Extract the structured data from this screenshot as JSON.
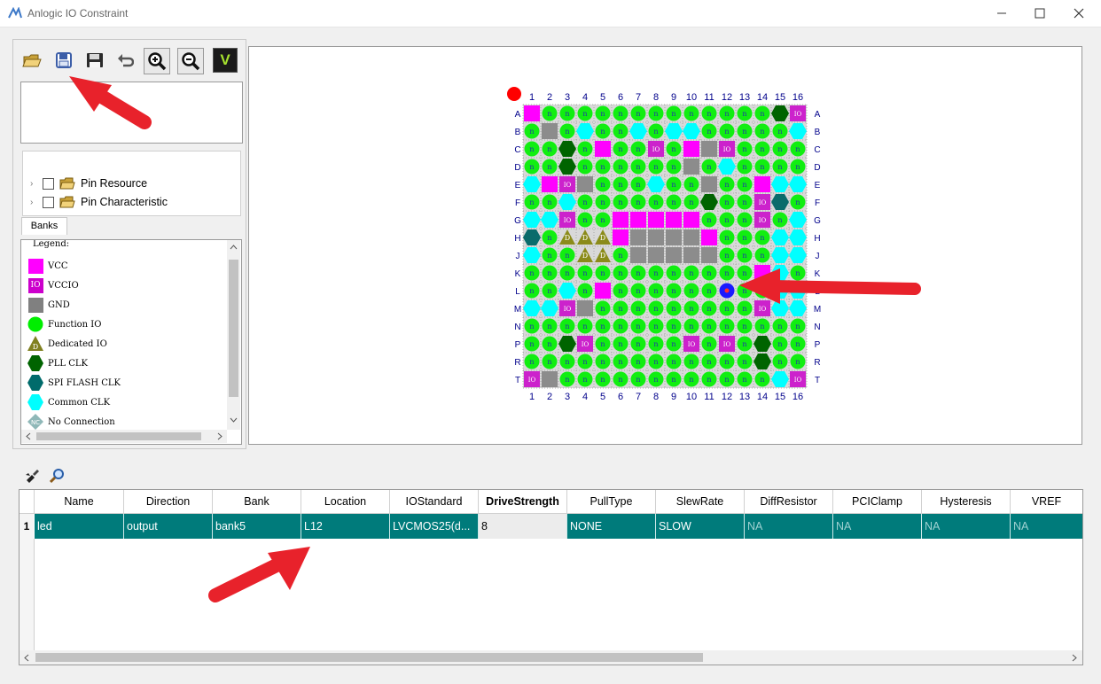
{
  "window": {
    "title": "Anlogic IO Constraint"
  },
  "toolbar": {
    "items": [
      "open-icon",
      "save-icon",
      "save-as-icon",
      "undo-icon",
      "zoom-in-icon",
      "zoom-out-icon",
      "validate-icon"
    ],
    "validate_label": "V"
  },
  "tree": {
    "items": [
      {
        "label": "Pin Resource"
      },
      {
        "label": "Pin Characteristic"
      }
    ]
  },
  "tabs": {
    "banks": "Banks"
  },
  "legend": {
    "title": "Legend:",
    "items": [
      {
        "label": "VCC",
        "icon": "vcc-swatch",
        "color": "#ff00ff"
      },
      {
        "label": "VCCIO",
        "icon": "vccio-swatch",
        "color": "#cc00cc",
        "text": "IO"
      },
      {
        "label": "GND",
        "icon": "gnd-swatch",
        "color": "#808080"
      },
      {
        "label": "Function IO",
        "icon": "function-io-circle",
        "color": "#00ee00"
      },
      {
        "label": "Dedicated IO",
        "icon": "dedicated-io-triangle",
        "color": "#808020",
        "text": "D"
      },
      {
        "label": "PLL CLK",
        "icon": "pll-clk-hexagon",
        "color": "#006400"
      },
      {
        "label": "SPI FLASH CLK",
        "icon": "spi-flash-clk-hexagon",
        "color": "#006b6b"
      },
      {
        "label": "Common CLK",
        "icon": "common-clk-hexagon",
        "color": "#00ffff"
      },
      {
        "label": "No Connection",
        "icon": "no-connection-diamond",
        "color": "#8fb8b8",
        "text": "NC"
      }
    ]
  },
  "pinmap": {
    "columns": [
      "1",
      "2",
      "3",
      "4",
      "5",
      "6",
      "7",
      "8",
      "9",
      "10",
      "11",
      "12",
      "13",
      "14",
      "15",
      "16"
    ],
    "rows": [
      "A",
      "B",
      "C",
      "D",
      "E",
      "F",
      "G",
      "H",
      "J",
      "K",
      "L",
      "M",
      "N",
      "P",
      "R",
      "T"
    ],
    "cells": [
      "VFFFFFFFFFFFFFPI",
      "FGFCFFCFCCFFFFFC",
      "FFPFVFFIFVGIFFFF",
      "FFPFFFFFFGFCFFFF",
      "CVIGFFFCFFGFFVCC",
      "FFCFFFFFFFPFFIXF",
      "CCIFFVVVVVFFFIFC",
      "XFDDDVGGGGVFFFCC",
      "CFFDDFGGGGGFFFCC",
      "FFFFFFFFFFFFFVCF",
      "FFCFVFFFFFFFFFCC",
      "CCIGFFFFFFFFFICC",
      "FFFFFFFFFFFFFFFF",
      "FFPIFFFFFIFIFPFF",
      "FFFFFFFFFFFFFPFF",
      "IGFFFFFFFFFFFFCI"
    ],
    "cell_labels": {
      "F": "n",
      "I": "IO",
      "D": "D"
    },
    "selected_pin": "L12",
    "colors": {
      "V": "#ff00ff",
      "I": "#cc22cc",
      "G": "#8c8c8c",
      "F": "#11ee11",
      "C": "#00ffff",
      "P": "#006400",
      "X": "#0a6b6b",
      "D": "#8b8b1a",
      "selected": "#1a1aff",
      "header": "#00008b",
      "corner": "#ff0000"
    }
  },
  "bottom_toolbar": {
    "items": [
      "clear-icon",
      "find-icon"
    ]
  },
  "table": {
    "columns": [
      "Name",
      "Direction",
      "Bank",
      "Location",
      "IOStandard",
      "DriveStrength",
      "PullType",
      "SlewRate",
      "DiffResistor",
      "PCIClamp",
      "Hysteresis",
      "VREF"
    ],
    "rows": [
      {
        "index": "1",
        "cells": [
          "led",
          "output",
          "bank5",
          "L12",
          "LVCMOS25(d...",
          "8",
          "NONE",
          "SLOW",
          "NA",
          "NA",
          "NA",
          "NA"
        ]
      }
    ]
  },
  "annotations": {
    "arrow_color": "#e8222b"
  }
}
